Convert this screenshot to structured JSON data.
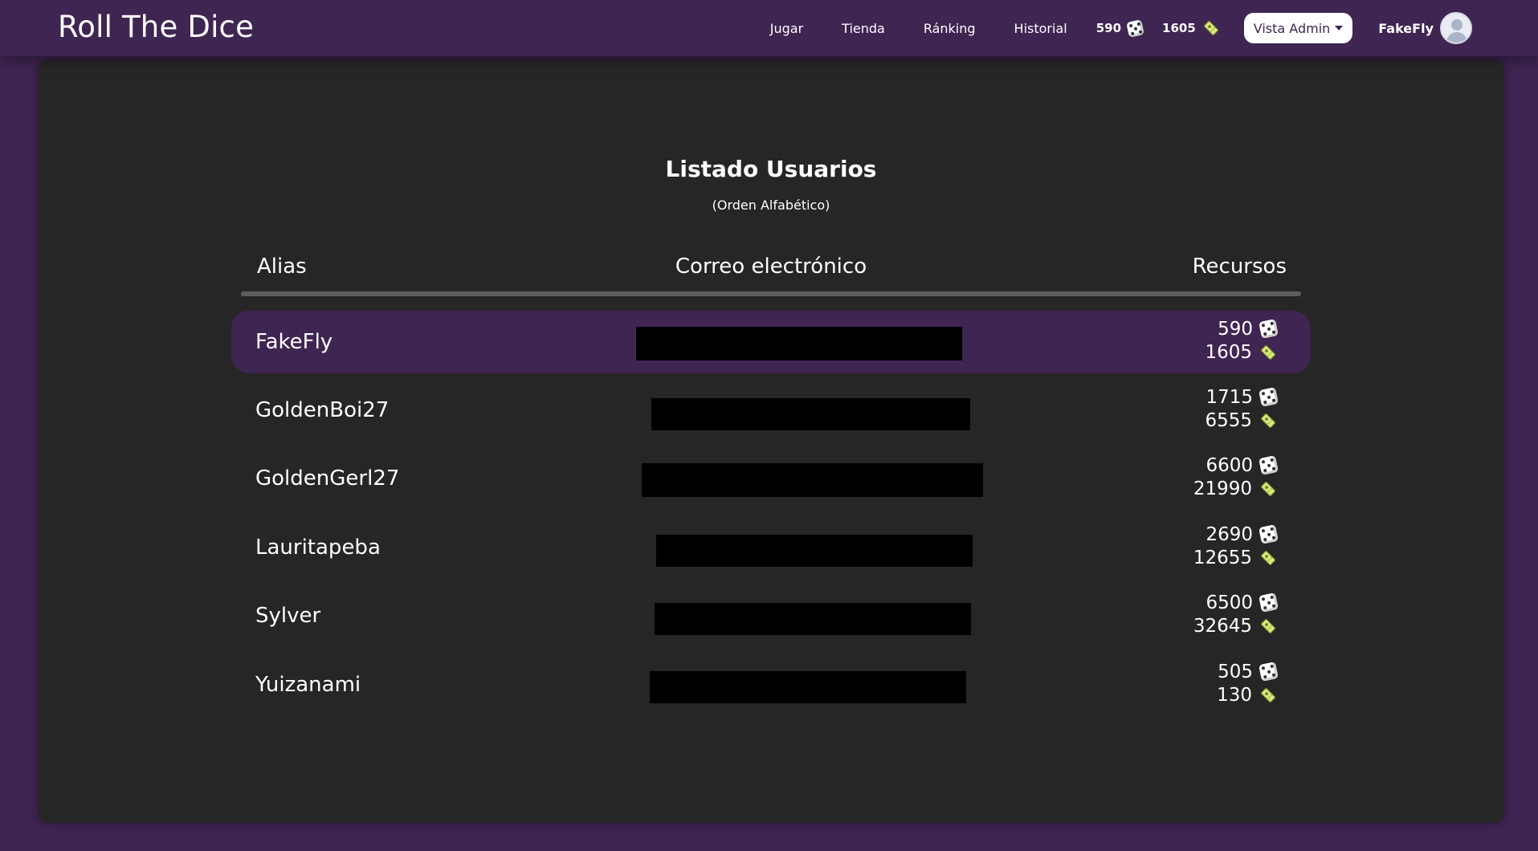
{
  "app": {
    "title": "Roll The Dice"
  },
  "nav": {
    "links": [
      "Jugar",
      "Tienda",
      "Ránking",
      "Historial"
    ],
    "dice_count": "590",
    "ticket_count": "1605",
    "admin_dropdown": "Vista Admin",
    "username": "FakeFly"
  },
  "page": {
    "title": "Listado Usuarios",
    "subtitle": "(Orden Alfabético)",
    "columns": {
      "alias": "Alias",
      "email": "Correo electrónico",
      "resources": "Recursos"
    }
  },
  "users": [
    {
      "alias": "FakeFly",
      "dice": "590",
      "tickets": "1605",
      "current": true
    },
    {
      "alias": "GoldenBoi27",
      "dice": "1715",
      "tickets": "6555",
      "current": false
    },
    {
      "alias": "GoldenGerl27",
      "dice": "6600",
      "tickets": "21990",
      "current": false
    },
    {
      "alias": "Lauritapeba",
      "dice": "2690",
      "tickets": "12655",
      "current": false
    },
    {
      "alias": "Sylver",
      "dice": "6500",
      "tickets": "32645",
      "current": false
    },
    {
      "alias": "Yuizanami",
      "dice": "505",
      "tickets": "130",
      "current": false
    }
  ],
  "icons": {
    "dice": "dice-icon",
    "tickets": "ticket-icon"
  },
  "colors": {
    "accent": "#3f2552",
    "panel": "#262626",
    "redaction": "#000000",
    "ticket": "#d9e87a"
  }
}
